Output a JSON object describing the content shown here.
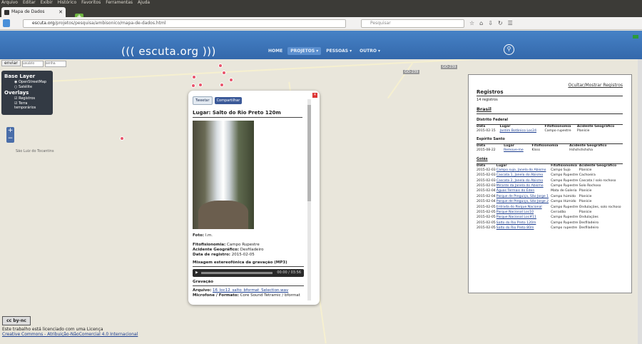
{
  "menubar": [
    "Arquivo",
    "Editar",
    "Exibir",
    "Histórico",
    "Favoritos",
    "Ferramentas",
    "Ajuda"
  ],
  "tab": {
    "title": "Mapa de Dados"
  },
  "url": {
    "host": "escuta.org",
    "path": "/projetos/pesquisa/ambisonico/mapa-de-dados.html"
  },
  "search": {
    "placeholder": "Pesquisar"
  },
  "site": {
    "brand": "((( escuta.org )))",
    "nav": [
      "HOME",
      "PROJETOS ▾",
      "PESSOAS ▾",
      "OUTRO ▾"
    ]
  },
  "login": {
    "button": "enviar",
    "user_placeholder": "usuário",
    "pass_placeholder": "senha"
  },
  "layers": {
    "base_title": "Base Layer",
    "base": [
      "OpenStreetMap",
      "Satélite"
    ],
    "overlays_title": "Overlays",
    "overlays": [
      "Registros",
      "Terra temporários"
    ]
  },
  "map_labels": {
    "city": "São Luiz do Tocantins",
    "road1": "GO-239",
    "road2": "GO-239"
  },
  "popup": {
    "tweet": "Tweetar",
    "share": "Compartilhar",
    "title": "Lugar: Salto do Rio Preto 120m",
    "foto_label": "Foto:",
    "foto_value": "l.m.",
    "fito_label": "Fitofisionomia:",
    "fito_value": "Campo Rupestre",
    "acid_label": "Acidente Geográfico:",
    "acid_value": "Desfiladeiro",
    "data_label": "Data de registro:",
    "data_value": "2015-02-05",
    "mix_title": "Mixagem estereofônica da gravação (MP3)",
    "player_time": "00:00 / 03:56",
    "grav_title": "Gravação",
    "arquivo_label": "Arquivo:",
    "arquivo_value": "16_loc12_salto_bformat_Selection.wav",
    "mic_label": "Microfone / Formato:",
    "mic_value": "Core Sound Tetramic / bformat"
  },
  "registros": {
    "toggle": "Ocultar/Mostrar Registros",
    "title": "Registros",
    "count": "14 registros",
    "country": "Brasil",
    "headers": [
      "Data",
      "Lugar",
      "Fitofisionomia",
      "Acidente Geográfico"
    ],
    "groups": [
      {
        "name": "Distrito Federal",
        "rows": [
          [
            "2015-02-15",
            "Jardim Botânico Loc24",
            "Campo rupestre",
            "Planície"
          ]
        ]
      },
      {
        "name": "Espírito Santo",
        "rows": [
          [
            "2015-08-22",
            "Remove-me",
            "Klsss",
            "Hshshshshsha"
          ]
        ]
      }
    ],
    "goias": "Goiás",
    "goias_rows": [
      [
        "2015-02-03",
        "Campo sujo, Janela do Abismo",
        "Campo Sujo",
        "Planície"
      ],
      [
        "2015-02-03",
        "Cascata 1, Janela do Abismo",
        "Campo Rupestre",
        "Cachoeira"
      ],
      [
        "2015-02-03",
        "Cascata 2, Janela do Abismo",
        "Campo Rupestre",
        "Cascata / solo rochoso"
      ],
      [
        "2015-02-03",
        "Mirante da Janela do Abismo",
        "Campo Rupestre",
        "Solo Rochoso"
      ],
      [
        "2015-02-04",
        "Águas Termais do Éden",
        "Mata de Galeria",
        "Planície"
      ],
      [
        "2015-02-04",
        "Parque de Preguiça, São Jorge 1",
        "Campo húmido",
        "Planície"
      ],
      [
        "2015-02-04",
        "Parque de Preguiça, São Jorge 2",
        "Campo Húmido",
        "Planície"
      ],
      [
        "2015-02-05",
        "Entrada do Parque Nacional",
        "Campo Rupestre",
        "Ondulações, solo rochoso"
      ],
      [
        "2015-02-05",
        "Parque Nacional Loc10",
        "Cerradão",
        "Planície"
      ],
      [
        "2015-02-05",
        "Parque Nacional Loc#11",
        "Campo Rupestre",
        "Ondulações"
      ],
      [
        "2015-02-05",
        "Salto do Rio Preto 120m",
        "Campo Rupestre",
        "Desfiladeiro"
      ],
      [
        "2015-02-05",
        "Salto do Rio Preto 80m",
        "Campo rupestre",
        "Desfiladeiro"
      ]
    ]
  },
  "footer": {
    "cc": "cc by-nc",
    "line1": "Este trabalho está licenciado com uma Licença",
    "link": "Creative Commons - Atribuição-NãoComercial 4.0 Internacional"
  }
}
